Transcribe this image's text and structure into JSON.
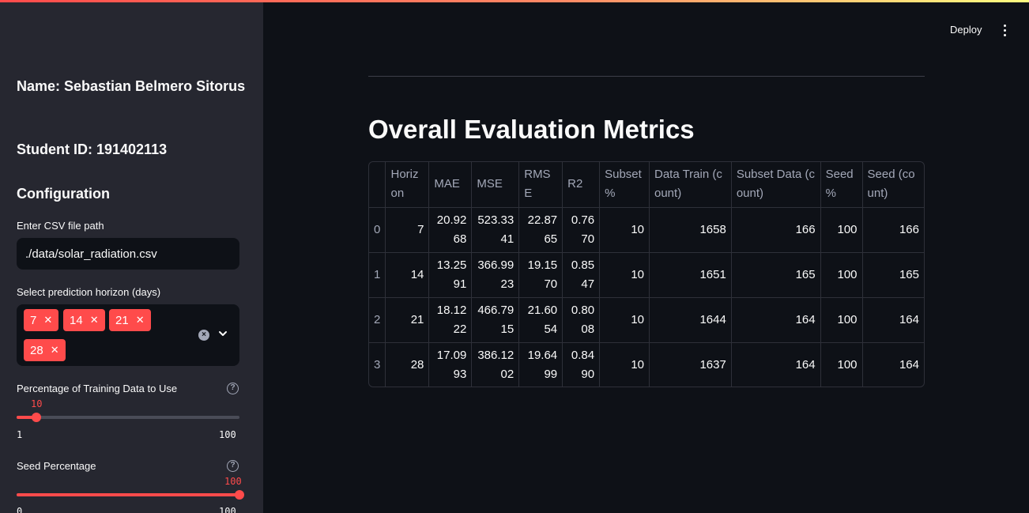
{
  "sidebar": {
    "name": "Name: Sebastian Belmero Sitorus",
    "student_id": "Student ID: 191402113",
    "config_heading": "Configuration",
    "csv_label": "Enter CSV file path",
    "csv_value": "./data/solar_radiation.csv",
    "horizon_label": "Select prediction horizon (days)",
    "horizon_selected": [
      "7",
      "14",
      "21",
      "28"
    ],
    "chip_remove": "✕",
    "training_label": "Percentage of Training Data to Use",
    "training_value": "10",
    "training_min": "1",
    "training_max": "100",
    "training_fraction": 0.09,
    "seed_label": "Seed Percentage",
    "seed_value": "100",
    "seed_min": "0",
    "seed_max": "100",
    "seed_fraction": 1.0,
    "help_glyph": "?"
  },
  "header": {
    "deploy_label": "Deploy",
    "menu_icon": "vertical-dots-icon"
  },
  "main": {
    "title": "Overall Evaluation Metrics",
    "table": {
      "columns": [
        "",
        "Horizon",
        "MAE",
        "MSE",
        "RMSE",
        "R2",
        "Subset %",
        "Data Train (count)",
        "Subset Data (count)",
        "Seed %",
        "Seed (count)"
      ],
      "rows": [
        [
          "0",
          "7",
          "20.9268",
          "523.3341",
          "22.8765",
          "0.7670",
          "10",
          "1658",
          "166",
          "100",
          "166"
        ],
        [
          "1",
          "14",
          "13.2591",
          "366.9923",
          "19.1570",
          "0.8547",
          "10",
          "1651",
          "165",
          "100",
          "165"
        ],
        [
          "2",
          "21",
          "18.1222",
          "466.7915",
          "21.6054",
          "0.8008",
          "10",
          "1644",
          "164",
          "100",
          "164"
        ],
        [
          "3",
          "28",
          "17.0993",
          "386.1202",
          "19.6499",
          "0.8490",
          "10",
          "1637",
          "164",
          "100",
          "164"
        ]
      ]
    }
  },
  "colors": {
    "accent": "#ff4b4b",
    "background": "#0e1117",
    "sidebar": "#262730"
  }
}
